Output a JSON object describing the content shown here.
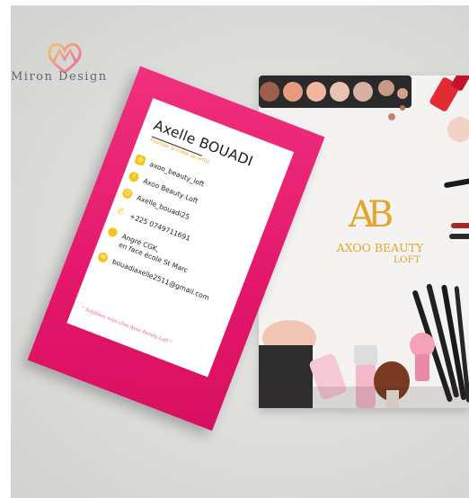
{
  "watermark": {
    "text": "Miron Design",
    "icon": "heart-m-logo-icon"
  },
  "back_card": {
    "monogram": "AB",
    "brand_name": "AXOO BEAUTY",
    "brand_sub": "LOFT"
  },
  "front_card": {
    "name": "Axelle BOUADI",
    "role": "Founder & make up artist",
    "contacts": [
      {
        "icon": "instagram-icon",
        "text": "axoo_beauty_loft"
      },
      {
        "icon": "facebook-icon",
        "text": "Axoo Beauty Loft"
      },
      {
        "icon": "snapchat-icon",
        "text": "Axelle_bouadi25"
      },
      {
        "icon": "phone-icon",
        "text": "+225 0749711691"
      },
      {
        "icon": "location-pin-icon",
        "text": "Angré CGK,"
      },
      {
        "icon": "location-pin-icon",
        "text": "en face école St Marc"
      },
      {
        "icon": "email-icon",
        "text": "bouadiaxelle2511@gmail.com"
      }
    ],
    "slogan": "\" Sublimez vous chez Axoo Beauty Loft \""
  },
  "colors": {
    "pink": "#e4176b",
    "gold": "#e2a62a",
    "icon_yellow": "#f5c518"
  }
}
